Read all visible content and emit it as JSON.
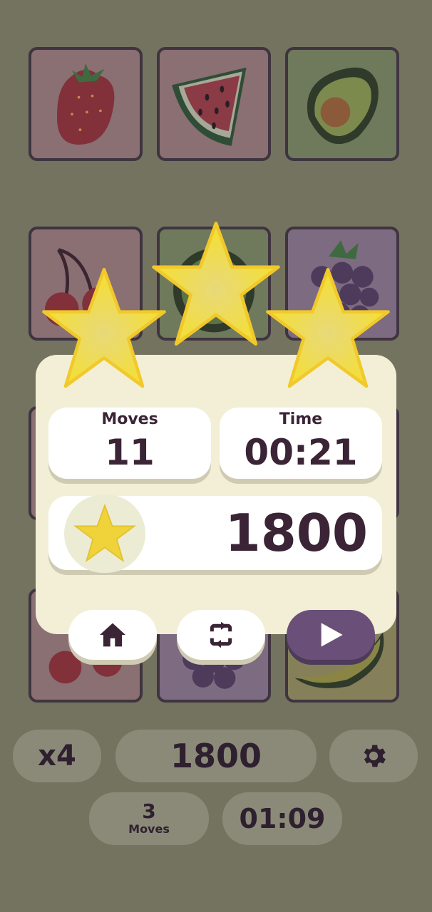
{
  "board": {
    "tiles": [
      {
        "fruit": "strawberry",
        "color": "#8a6f73"
      },
      {
        "fruit": "watermelon",
        "color": "#8a6f73"
      },
      {
        "fruit": "avocado",
        "color": "#6e7a5b"
      },
      {
        "fruit": "cherry",
        "color": "#8a6f73"
      },
      {
        "fruit": "kiwi",
        "color": "#6e7a5b"
      },
      {
        "fruit": "blackberry",
        "color": "#7d6b82"
      },
      {
        "fruit": "hidden",
        "color": "#8a6f73"
      },
      {
        "fruit": "hidden",
        "color": "#8a6f73"
      },
      {
        "fruit": "hidden",
        "color": "#8a6f73"
      },
      {
        "fruit": "cherry",
        "color": "#8a6f73"
      },
      {
        "fruit": "blackberry",
        "color": "#7d6b82"
      },
      {
        "fruit": "banana",
        "color": "#85805a"
      }
    ]
  },
  "results": {
    "stars_earned": 3,
    "moves_label": "Moves",
    "moves_value": "11",
    "time_label": "Time",
    "time_value": "00:21",
    "score_value": "1800",
    "buttons": [
      "home-icon",
      "restart-icon",
      "play-icon"
    ]
  },
  "hud": {
    "multiplier": "x4",
    "score": "1800",
    "settings_icon": "gear-icon",
    "moves_value": "3",
    "moves_label": "Moves",
    "timer": "01:09"
  },
  "colors": {
    "background": "#74735f",
    "panel": "#f2efd6",
    "accent_purple": "#6a5079",
    "text_dark": "#3a2436",
    "star": "#f3d73a"
  }
}
